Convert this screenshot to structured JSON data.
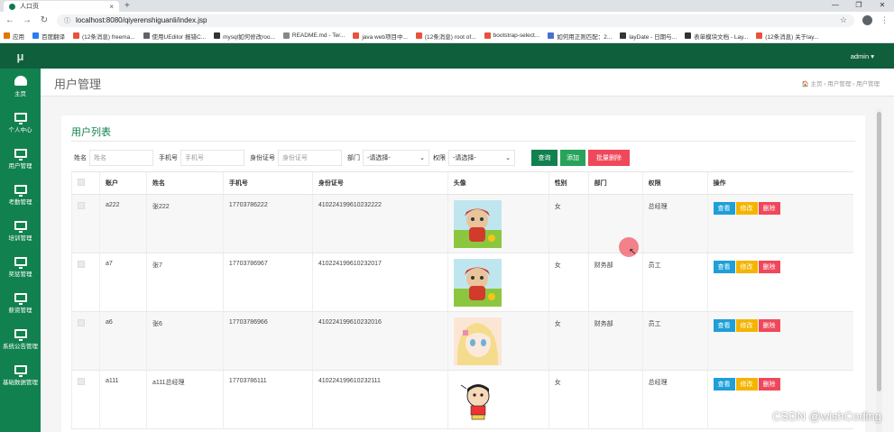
{
  "browser": {
    "tab_title": "人口页",
    "close_symbol": "×",
    "new_tab_symbol": "+",
    "address": "localhost:8080/qiyerenshiguanli/index.jsp",
    "window_controls": [
      "—",
      "❐",
      "✕"
    ],
    "bookmarks": [
      {
        "label": "应用",
        "color": "#e37400"
      },
      {
        "label": "百度翻译",
        "color": "#2b7de9"
      },
      {
        "label": "(12条消息) freema...",
        "color": "#e5533c"
      },
      {
        "label": "使用UEditor 报错C...",
        "color": "#5f6368"
      },
      {
        "label": "mysql如何修改roo...",
        "color": "#333333"
      },
      {
        "label": "README.md - Ter...",
        "color": "#888888"
      },
      {
        "label": "java web项目中...",
        "color": "#e5533c"
      },
      {
        "label": "(12条消息) root of...",
        "color": "#e5533c"
      },
      {
        "label": "bootstrap-select...",
        "color": "#e5533c"
      },
      {
        "label": "如何用正则匹配：2...",
        "color": "#4a6fd1"
      },
      {
        "label": "layDate - 日期与...",
        "color": "#333333"
      },
      {
        "label": "表单模块文档 - Lay...",
        "color": "#333333"
      },
      {
        "label": "(12条消息) 关于lay...",
        "color": "#e5533c"
      }
    ]
  },
  "app": {
    "logo": "μ",
    "user": "admin ▾",
    "sidebar": [
      {
        "label": "主页",
        "icon": "dashboard-icon"
      },
      {
        "label": "个人中心",
        "icon": "monitor-icon"
      },
      {
        "label": "用户管理",
        "icon": "monitor-icon"
      },
      {
        "label": "考勤管理",
        "icon": "monitor-icon"
      },
      {
        "label": "培训管理",
        "icon": "monitor-icon"
      },
      {
        "label": "奖惩管理",
        "icon": "monitor-icon"
      },
      {
        "label": "薪资管理",
        "icon": "monitor-icon"
      },
      {
        "label": "系统公告管理",
        "icon": "monitor-icon"
      },
      {
        "label": "基础数据管理",
        "icon": "monitor-icon"
      }
    ],
    "page_title": "用户管理",
    "breadcrumb": "🏠 主页 › 用户管理 › 用户管理",
    "panel_title": "用户列表",
    "filters": {
      "name_label": "姓名",
      "name_placeholder": "姓名",
      "phone_label": "手机号",
      "phone_placeholder": "手机号",
      "id_label": "身份证号",
      "id_placeholder": "身份证号",
      "dept_label": "部门",
      "dept_value": "-请选择-",
      "role_label": "权限",
      "role_value": "-请选择-",
      "query_btn": "查询",
      "add_btn": "添加",
      "batch_delete_btn": "批量删除"
    },
    "columns": [
      "",
      "账户",
      "姓名",
      "手机号",
      "身份证号",
      "头像",
      "性别",
      "部门",
      "权限",
      "操作"
    ],
    "actions": {
      "view": "查看",
      "edit": "修改",
      "delete": "删除"
    },
    "rows": [
      {
        "account": "a222",
        "name": "张222",
        "phone": "17703786222",
        "id_no": "410224199610232222",
        "avatar": "red-girl",
        "gender": "女",
        "dept": "",
        "role": "总经理"
      },
      {
        "account": "a7",
        "name": "张7",
        "phone": "17703786967",
        "id_no": "410224199610232017",
        "avatar": "red-girl",
        "gender": "女",
        "dept": "财务部",
        "role": "员工"
      },
      {
        "account": "a6",
        "name": "张6",
        "phone": "17703786966",
        "id_no": "410224199610232016",
        "avatar": "anime-girl",
        "gender": "女",
        "dept": "财务部",
        "role": "员工"
      },
      {
        "account": "a111",
        "name": "a111总经理",
        "phone": "17703786111",
        "id_no": "410224199610232111",
        "avatar": "shinchan",
        "gender": "女",
        "dept": "",
        "role": "总经理"
      }
    ],
    "watermark": "CSDN @wishCoding",
    "colors": {
      "header": "#0f5f3c",
      "sidebar": "#11814f",
      "accent": "#11814f",
      "view": "#1e9fd8",
      "edit": "#f4b400",
      "delete": "#f0485b"
    }
  }
}
